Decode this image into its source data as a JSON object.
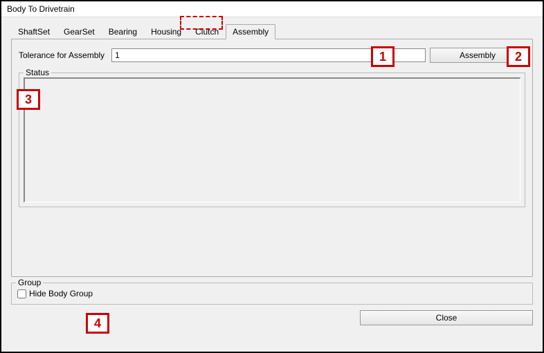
{
  "window": {
    "title": "Body To Drivetrain"
  },
  "tabs": [
    {
      "label": "ShaftSet"
    },
    {
      "label": "GearSet"
    },
    {
      "label": "Bearing"
    },
    {
      "label": "Housing"
    },
    {
      "label": "Clutch"
    },
    {
      "label": "Assembly",
      "active": true
    }
  ],
  "tolerance": {
    "label": "Tolerance for Assembly",
    "value": "1"
  },
  "assembly_button": "Assembly",
  "status": {
    "label": "Status",
    "text": ""
  },
  "group": {
    "label": "Group",
    "hide_body_label": "Hide Body Group",
    "hide_body_checked": false
  },
  "close_button": "Close",
  "callouts": {
    "c1": "1",
    "c2": "2",
    "c3": "3",
    "c4": "4"
  }
}
